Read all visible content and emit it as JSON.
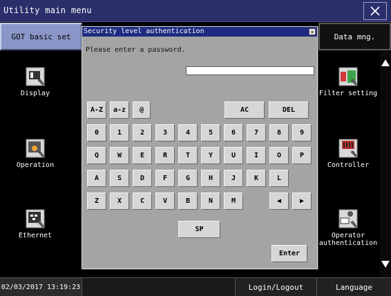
{
  "window": {
    "title": "Utility main menu"
  },
  "tabs": {
    "active": "GOT basic set",
    "data": "Data mng."
  },
  "menu_items": [
    {
      "label": "Display",
      "icon": "display-icon"
    },
    {
      "label": "Operation",
      "icon": "operation-icon"
    },
    {
      "label": "Ethernet",
      "icon": "ethernet-icon"
    },
    {
      "label": "Filter setting",
      "icon": "filter-setting-icon"
    },
    {
      "label": "Controller",
      "icon": "controller-icon"
    },
    {
      "label": "Operator authentication",
      "icon": "operator-authentication-icon"
    }
  ],
  "dialog": {
    "title": "Security level authentication",
    "prompt": "Please enter a password.",
    "password_value": "",
    "row_mode": [
      "A-Z",
      "a-z",
      "@"
    ],
    "ac": "AC",
    "del": "DEL",
    "row_digits": [
      "0",
      "1",
      "2",
      "3",
      "4",
      "5",
      "6",
      "7",
      "8",
      "9"
    ],
    "row_q": [
      "Q",
      "W",
      "E",
      "R",
      "T",
      "Y",
      "U",
      "I",
      "O",
      "P"
    ],
    "row_a": [
      "A",
      "S",
      "D",
      "F",
      "G",
      "H",
      "J",
      "K",
      "L"
    ],
    "row_z": [
      "Z",
      "X",
      "C",
      "V",
      "B",
      "N",
      "M"
    ],
    "left_arrow": "◀",
    "right_arrow": "▶",
    "space": "SP",
    "enter": "Enter"
  },
  "status": {
    "datetime": "02/03/2017 13:19:23",
    "login": "Login/Logout",
    "language": "Language"
  }
}
